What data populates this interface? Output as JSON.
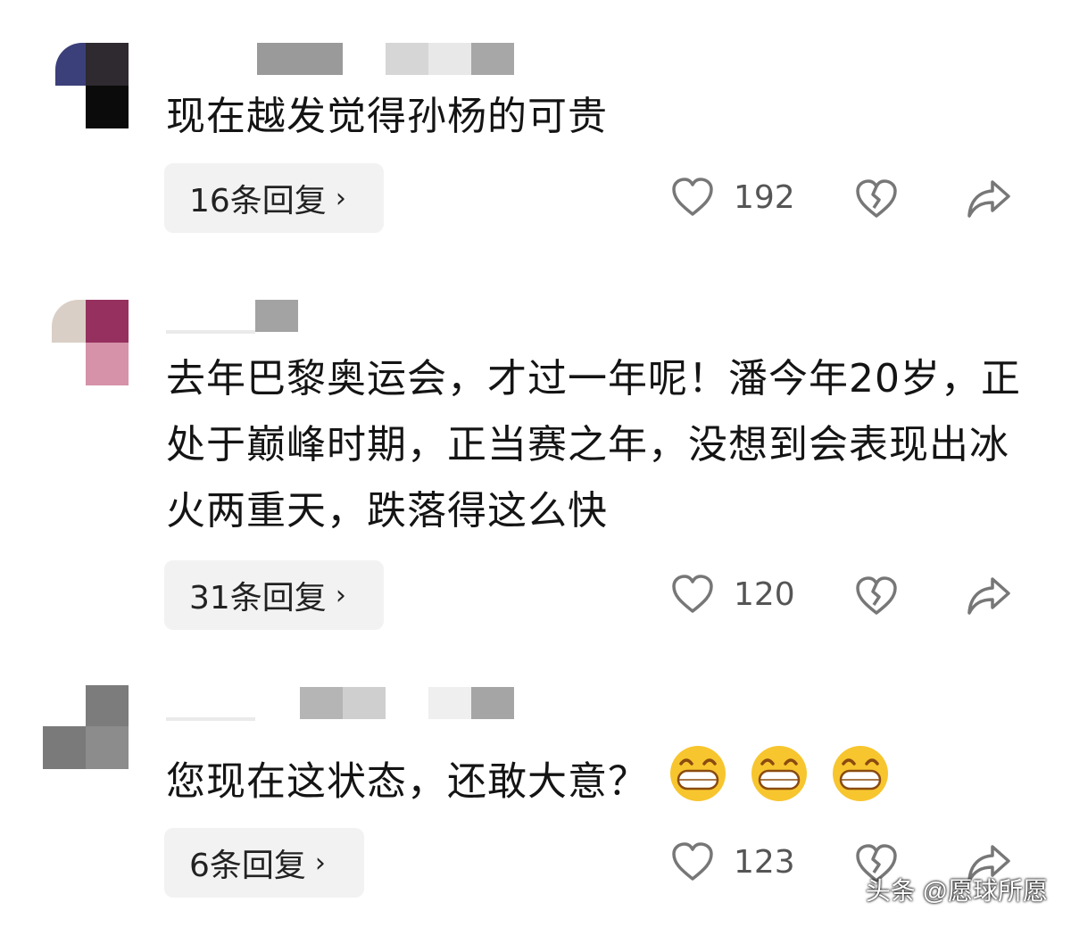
{
  "comments": [
    {
      "text": "现在越发觉得孙杨的可贵",
      "reply_label": "16条回复",
      "likes": "192"
    },
    {
      "text": "去年巴黎奥运会，才过一年呢！潘今年20岁，正处于巅峰时期，正当赛之年，没想到会表现出冰火两重天，跌落得这么快",
      "reply_label": "31条回复",
      "likes": "120"
    },
    {
      "text": "您现在这状态，还敢大意？",
      "reply_label": "6条回复",
      "likes": "123"
    }
  ],
  "icons": {
    "like": "heart-outline-icon",
    "dislike": "broken-heart-icon",
    "share": "share-arrow-icon",
    "reply_chevron": "chevron-right-icon",
    "emoji": "grinning-face-emoji"
  },
  "chevron": "›",
  "watermark": "头条 @愿球所愿",
  "colors": {
    "reply_bg": "#f2f2f2",
    "text": "#141414",
    "count": "#555555"
  }
}
